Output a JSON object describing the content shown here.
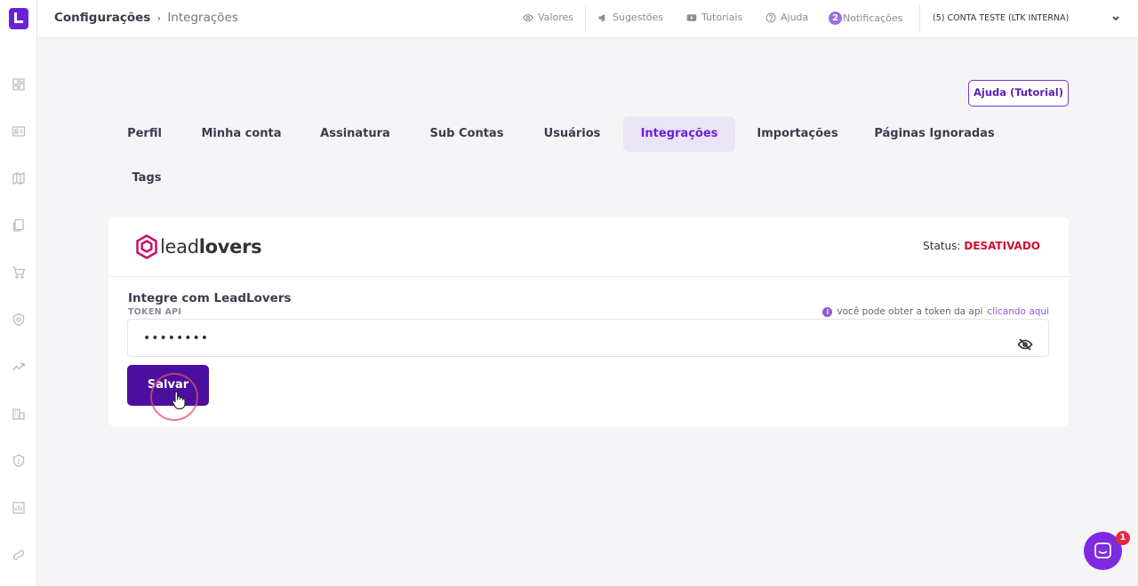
{
  "colors": {
    "accent": "#6a22d8",
    "primary_button": "#4b0f9f",
    "status_off": "#d0102f",
    "background": "#f5f5f7"
  },
  "sidebar": {
    "logo_icon": "app-logo-icon",
    "items": [
      {
        "icon": "dashboard-icon"
      },
      {
        "icon": "contact-card-icon"
      },
      {
        "icon": "map-icon"
      },
      {
        "icon": "pages-icon"
      },
      {
        "icon": "cart-icon"
      },
      {
        "icon": "shield-badge-icon"
      },
      {
        "icon": "trending-icon"
      },
      {
        "icon": "building-icon"
      },
      {
        "icon": "security-icon"
      },
      {
        "icon": "report-chart-icon"
      },
      {
        "icon": "link-icon"
      }
    ]
  },
  "header": {
    "breadcrumb_parent": "Configurações",
    "breadcrumb_separator": "›",
    "breadcrumb_current": "Integrações",
    "links": {
      "valores": "Valores",
      "sugestoes": "Sugestões",
      "tutoriais": "Tutoriais",
      "ajuda": "Ajuda",
      "notificacoes": "Notificações",
      "notificacoes_count": "2"
    },
    "account": "(5) CONTA TESTE (LTK INTERNA)"
  },
  "help_button": "Ajuda (Tutorial)",
  "tabs": [
    {
      "label": "Perfil"
    },
    {
      "label": "Minha conta"
    },
    {
      "label": "Assinatura"
    },
    {
      "label": "Sub Contas"
    },
    {
      "label": "Usuários"
    },
    {
      "label": "Integrações",
      "active": true
    },
    {
      "label": "Importações"
    },
    {
      "label": "Páginas Ignoradas"
    },
    {
      "label": "Tags"
    }
  ],
  "integration": {
    "brand_light": "lead",
    "brand_bold": "lovers",
    "status_label": "Status:",
    "status_value": "DESATIVADO",
    "title": "Integre com LeadLovers",
    "token_label": "TOKEN API",
    "hint_text": "você pode obter a token da api",
    "hint_link": "clicando aqui",
    "token_value": "••••••••",
    "save_label": "Salvar"
  },
  "chat": {
    "badge": "1"
  }
}
